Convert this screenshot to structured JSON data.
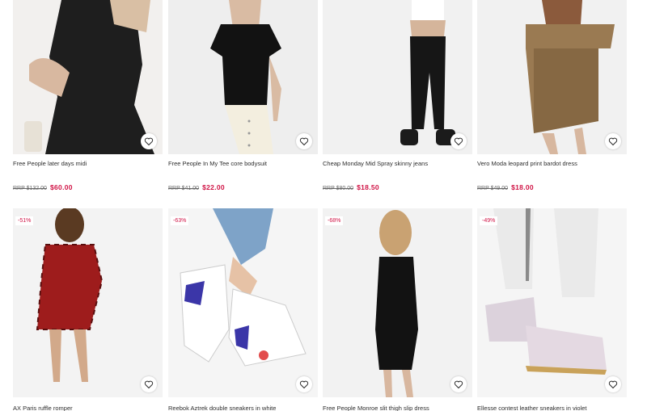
{
  "colors": {
    "sale": "#d01345",
    "text": "#2d2d2d",
    "image_bg": "#efefef"
  },
  "save_icon": "heart-icon",
  "products_row1": [
    {
      "title": "Free People later days midi",
      "rrp": "RRP $132.00",
      "sale": "$60.00"
    },
    {
      "title": "Free People In My Tee core bodysuit",
      "rrp": "RRP $41.00",
      "sale": "$22.00"
    },
    {
      "title": "Cheap Monday Mid Spray skinny jeans",
      "rrp": "RRP $80.00",
      "sale": "$18.50"
    },
    {
      "title": "Vero Moda leopard print bardot dress",
      "rrp": "RRP $49.00",
      "sale": "$18.00"
    }
  ],
  "products_row2": [
    {
      "title": "AX Paris ruffle romper",
      "badge": "-51%"
    },
    {
      "title": "Reebok Aztrek double sneakers in white",
      "badge": "-63%"
    },
    {
      "title": "Free People Monroe slit thigh slip dress",
      "badge": "-68%"
    },
    {
      "title": "Ellesse contest leather sneakers in violet",
      "badge": "-49%"
    }
  ]
}
